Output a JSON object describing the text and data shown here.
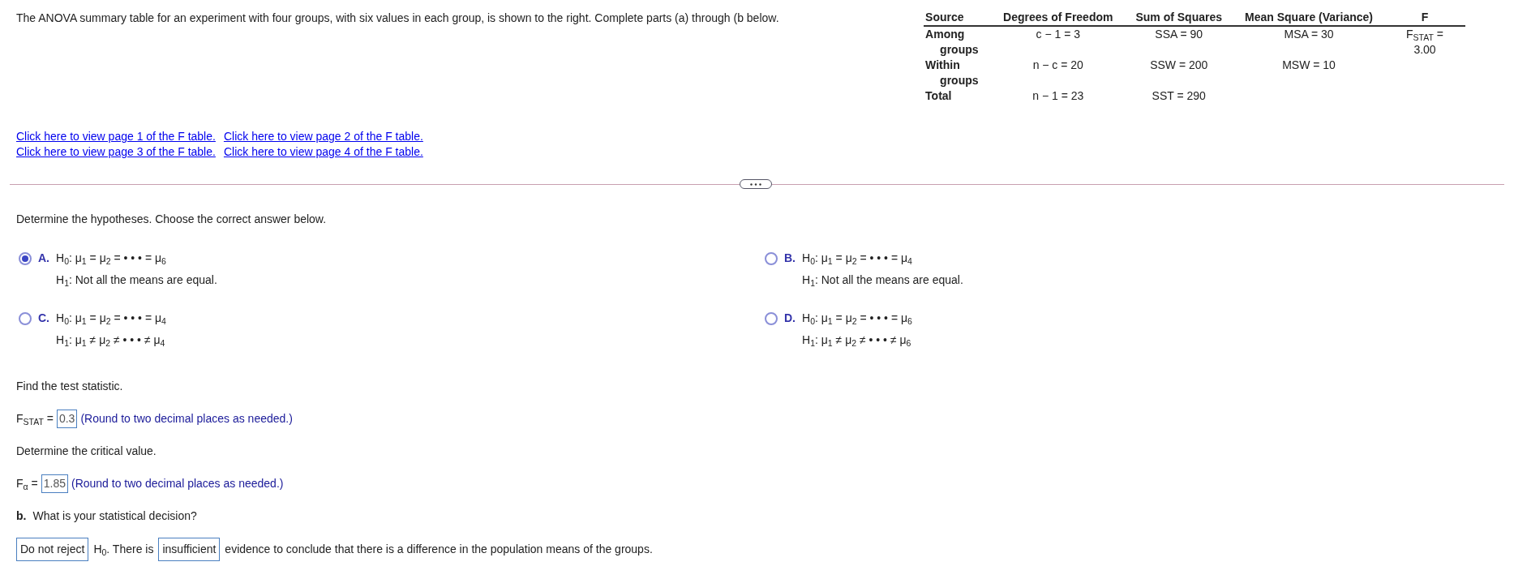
{
  "prompt": "The ANOVA summary table for an experiment with four groups, with six values in each group, is shown to the right. Complete parts (a) through (b below.",
  "table": {
    "columns": [
      "Source",
      "Degrees of Freedom",
      "Sum of Squares",
      "Mean Square (Variance)",
      "F"
    ],
    "rows": [
      [
        "Among groups",
        "c − 1 = 3",
        "SSA = 90",
        "MSA = 30",
        "F$_{STAT}$ = 3.00"
      ],
      [
        "Within groups",
        "n − c = 20",
        "SSW = 200",
        "MSW = 10",
        ""
      ],
      [
        "Total",
        "n − 1 = 23",
        "SST = 290",
        "",
        ""
      ]
    ]
  },
  "links": [
    [
      "Click here to view page 1 of the F table.",
      "Click here to view page 2 of the F table."
    ],
    [
      "Click here to view page 3 of the F table.",
      "Click here to view page 4 of the F table."
    ]
  ],
  "hypotheses": {
    "question": "Determine the hypotheses. Choose the correct answer below.",
    "options": [
      {
        "letter": "A.",
        "h0": "H$_{0}$: μ$_{1}$ = μ$_{2}$ = • • • = μ$_{6}$",
        "h1": "H$_{1}$: Not all the means are equal.",
        "selected": true
      },
      {
        "letter": "B.",
        "h0": "H$_{0}$: μ$_{1}$ = μ$_{2}$ = • • • = μ$_{4}$",
        "h1": "H$_{1}$: Not all the means are equal.",
        "selected": false
      },
      {
        "letter": "C.",
        "h0": "H$_{0}$: μ$_{1}$ = μ$_{2}$ = • • • = μ$_{4}$",
        "h1": "H$_{1}$: μ$_{1}$ ≠ μ$_{2}$ ≠ • • • ≠ μ$_{4}$",
        "selected": false
      },
      {
        "letter": "D.",
        "h0": "H$_{0}$: μ$_{1}$ = μ$_{2}$ = • • • = μ$_{6}$",
        "h1": "H$_{1}$: μ$_{1}$ ≠ μ$_{2}$ ≠ • • • ≠ μ$_{6}$",
        "selected": false
      }
    ]
  },
  "test_statistic": {
    "question": "Find the test statistic.",
    "label": "F$_{STAT}$ =",
    "value": "0.3",
    "hint": "(Round to two decimal places as needed.)"
  },
  "critical_value": {
    "question": "Determine the critical value.",
    "label": "F$_{α}$ =",
    "value": "1.85",
    "hint": "(Round to two decimal places as needed.)"
  },
  "part_b": {
    "letter": "b.",
    "question": "What is your statistical decision?",
    "parts": [
      {
        "kind": "answer",
        "text": "Do not reject"
      },
      {
        "kind": "text",
        "text": "H$_{0}$. There is"
      },
      {
        "kind": "answer",
        "text": "insufficient"
      },
      {
        "kind": "text",
        "text": "evidence to conclude that there is a difference in the population means of the groups."
      }
    ]
  }
}
